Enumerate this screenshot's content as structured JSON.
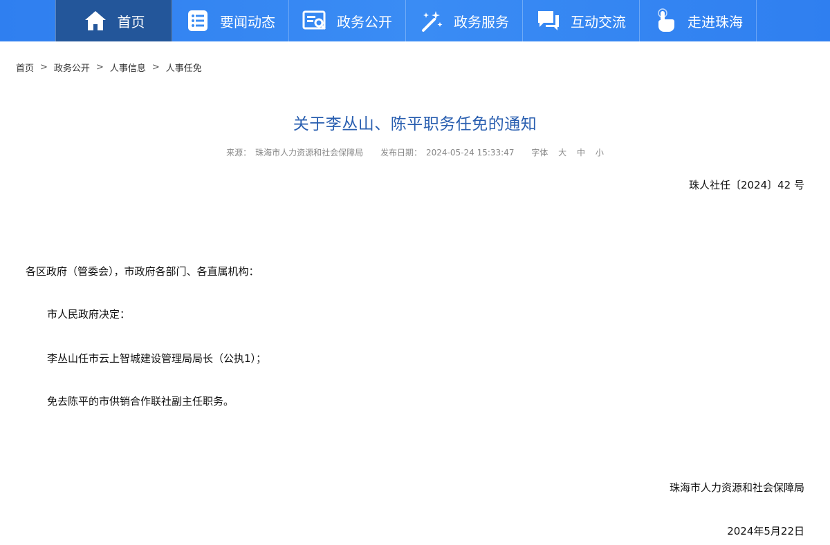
{
  "nav": {
    "items": [
      {
        "label": "首页",
        "icon": "home-icon"
      },
      {
        "label": "要闻动态",
        "icon": "news-list-icon"
      },
      {
        "label": "政务公开",
        "icon": "document-search-icon"
      },
      {
        "label": "政务服务",
        "icon": "magic-wand-icon"
      },
      {
        "label": "互动交流",
        "icon": "chat-bubbles-icon"
      },
      {
        "label": "走进珠海",
        "icon": "hand-pointer-icon"
      }
    ],
    "active_index": 0
  },
  "breadcrumb": {
    "items": [
      "首页",
      "政务公开",
      "人事信息",
      "人事任免"
    ],
    "separator": ">"
  },
  "article": {
    "title": "关于李丛山、陈平职务任免的通知",
    "meta": {
      "source_label": "来源：",
      "source": "珠海市人力资源和社会保障局",
      "date_label": "发布日期：",
      "date": "2024-05-24 15:33:47",
      "font_label": "字体",
      "font_sizes": [
        "大",
        "中",
        "小"
      ]
    },
    "doc_number": "珠人社任〔2024〕42 号",
    "salutation": "各区政府（管委会），市政府各部门、各直属机构：",
    "decision": "市人民政府决定：",
    "appointment": "李丛山任市云上智城建设管理局局长（公执1）；",
    "dismissal": "免去陈平的市供销合作联社副主任职务。",
    "signoff_org": "珠海市人力资源和社会保障局",
    "signoff_date": "2024年5月22日"
  },
  "colors": {
    "nav_bar": "#3a8cf4",
    "nav_active": "#23569a",
    "title": "#2a5fb0"
  }
}
